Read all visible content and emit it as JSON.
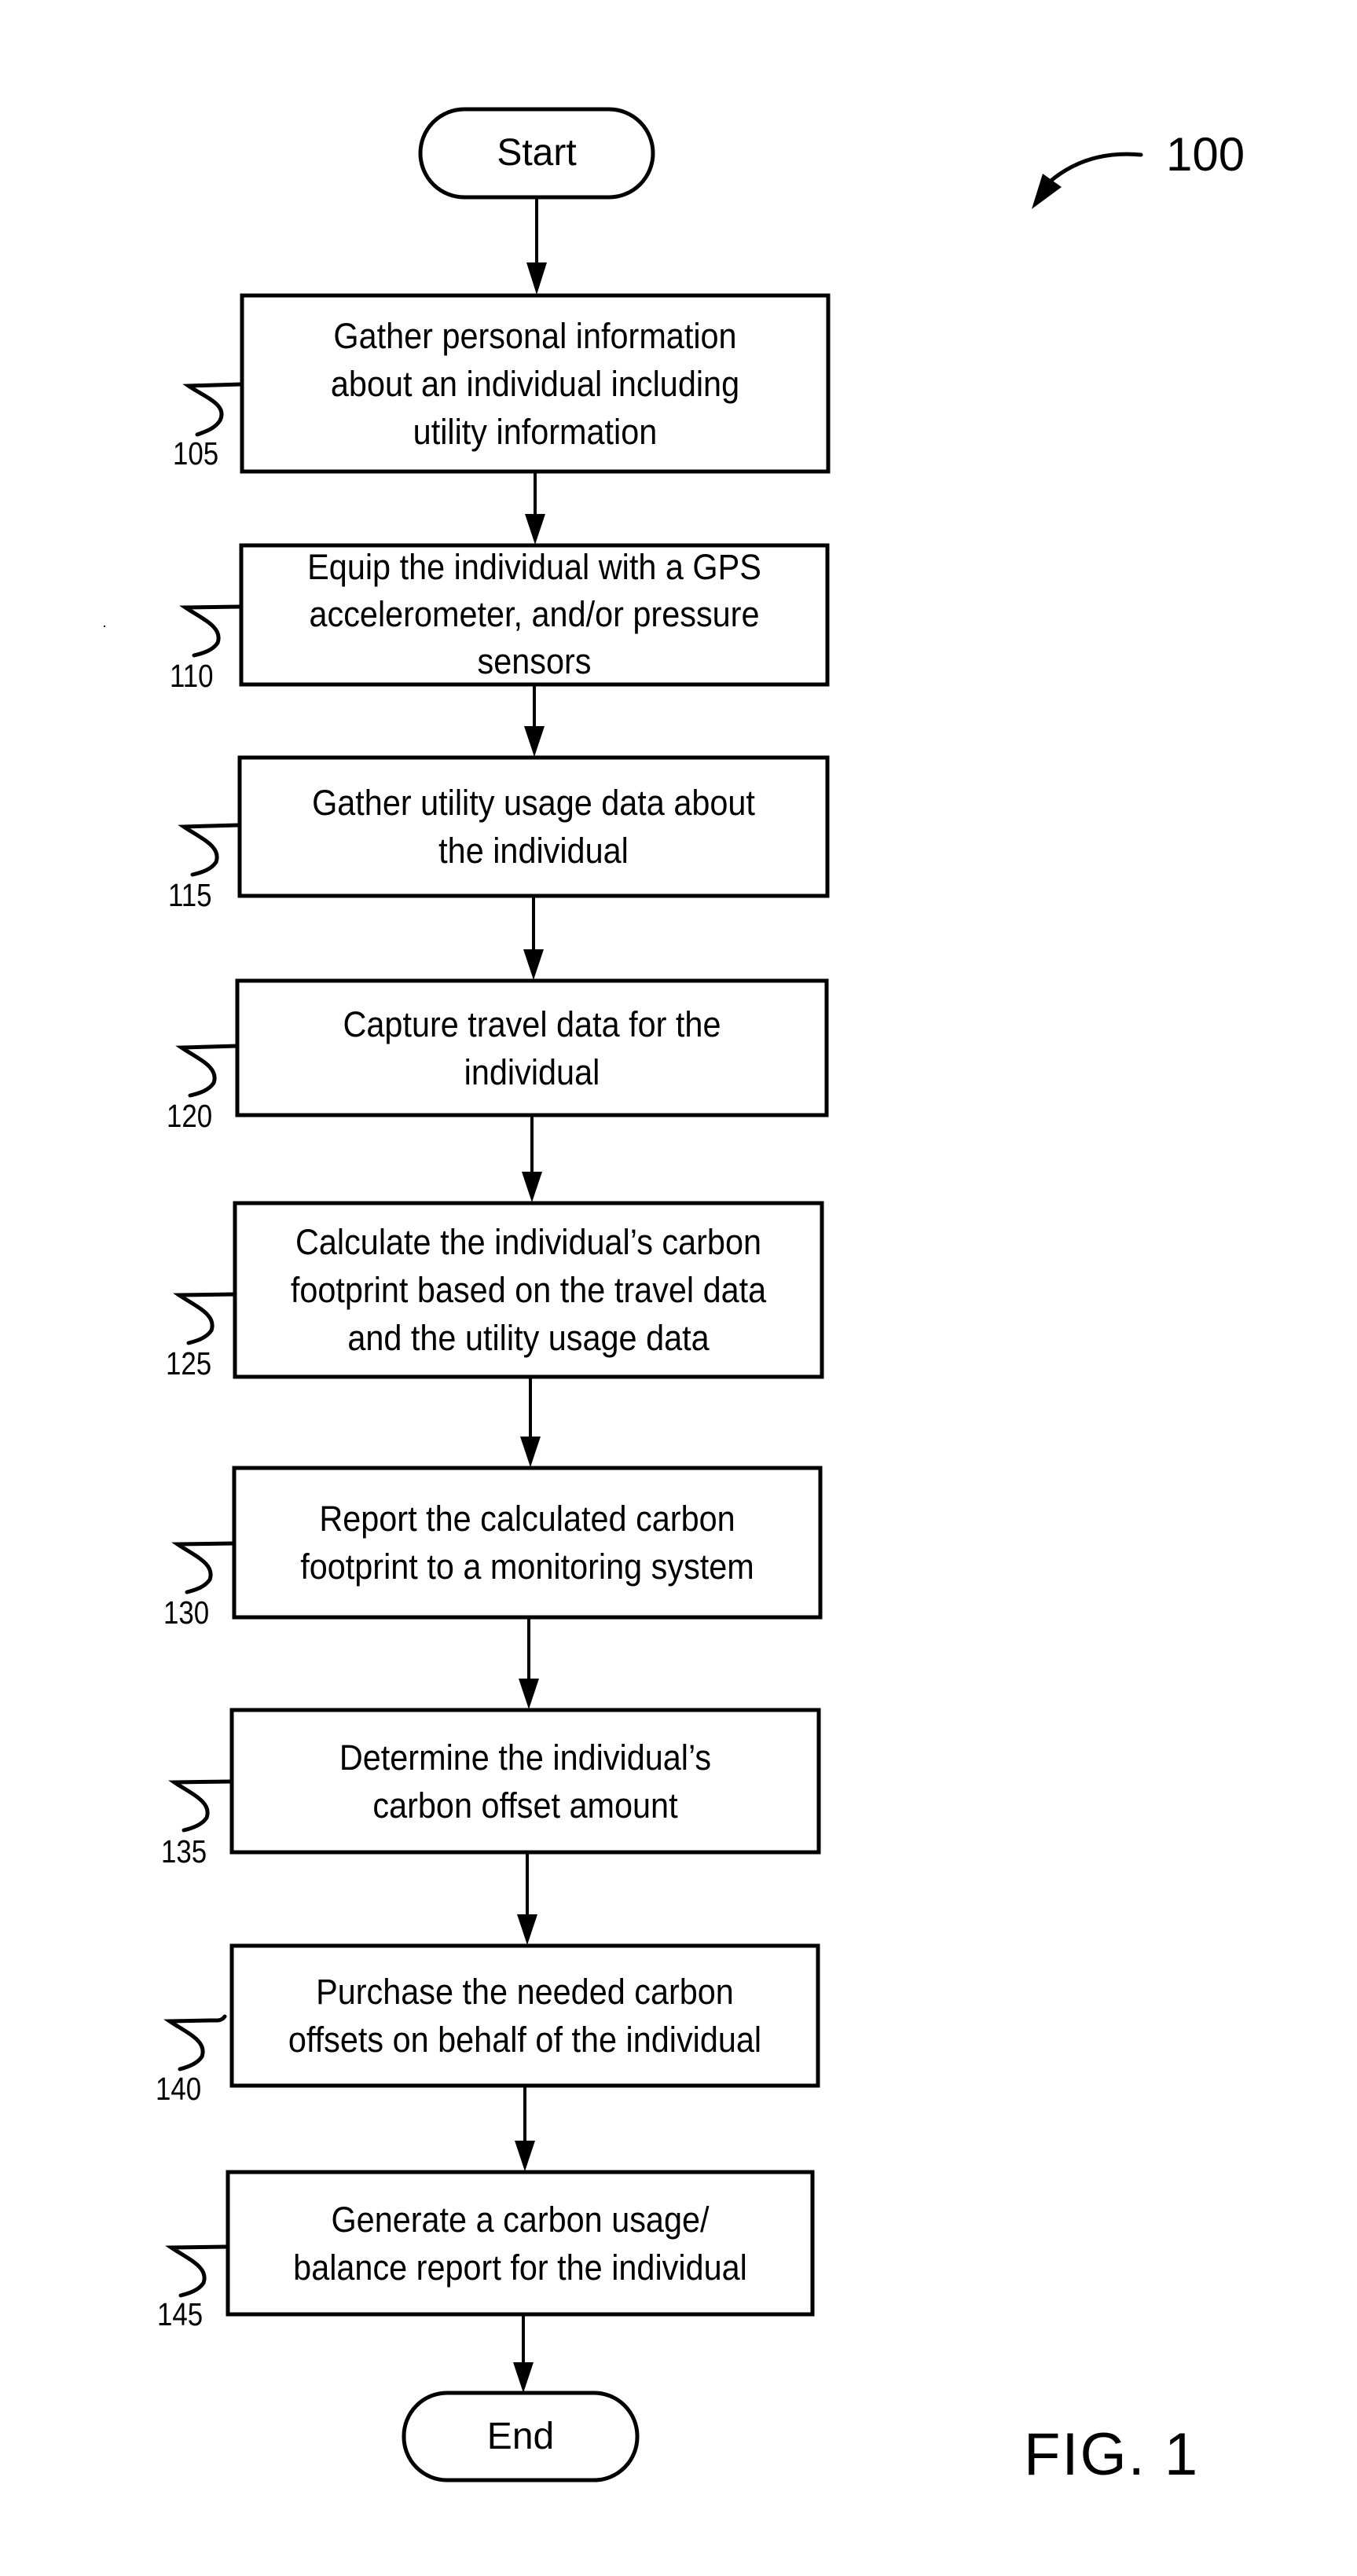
{
  "figure": {
    "reference_number": "100",
    "label": "FIG. 1"
  },
  "start": {
    "label": "Start"
  },
  "end": {
    "label": "End"
  },
  "steps": [
    {
      "ref": "105",
      "text": "Gather personal information\nabout an individual including\nutility information"
    },
    {
      "ref": "110",
      "text": "Equip the individual with a GPS\naccelerometer, and/or pressure\nsensors"
    },
    {
      "ref": "115",
      "text": "Gather utility usage data about\nthe individual"
    },
    {
      "ref": "120",
      "text": "Capture travel data for the\nindividual"
    },
    {
      "ref": "125",
      "text": "Calculate the individual’s carbon\nfootprint based on the travel data\nand the utility usage data"
    },
    {
      "ref": "130",
      "text": "Report the calculated carbon\nfootprint to a monitoring system"
    },
    {
      "ref": "135",
      "text": "Determine the individual’s\ncarbon offset amount"
    },
    {
      "ref": "140",
      "text": "Purchase the needed carbon\noffsets on behalf of the individual"
    },
    {
      "ref": "145",
      "text": "Generate a carbon usage/\nbalance report for the individual"
    }
  ]
}
